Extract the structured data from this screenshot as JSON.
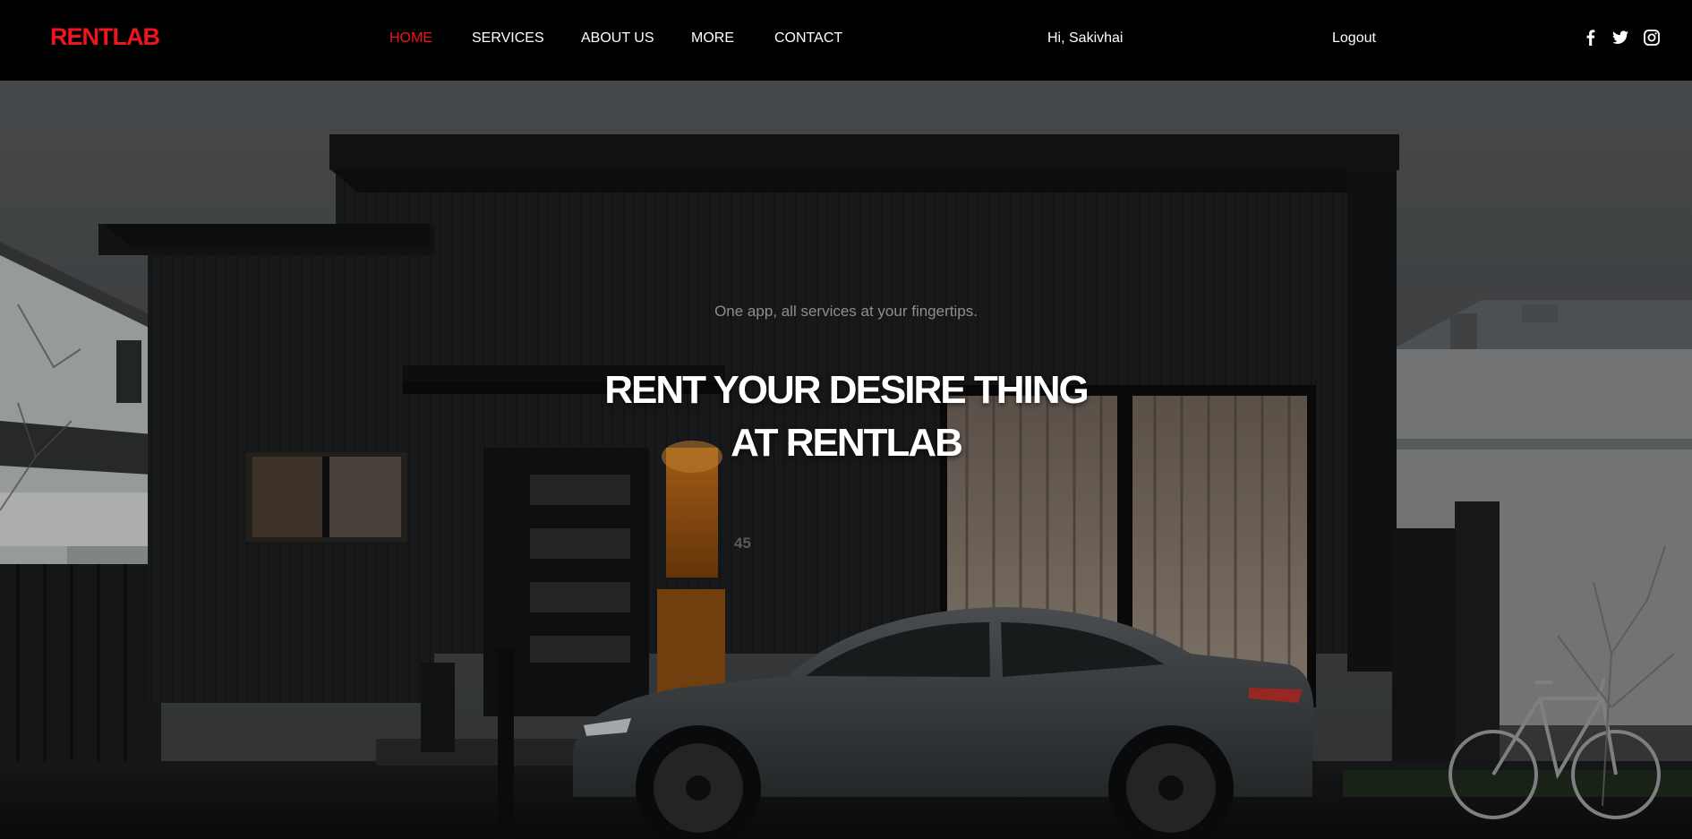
{
  "brand": {
    "name": "RENTLAB",
    "color": "#f0141e"
  },
  "nav": {
    "items": [
      {
        "label": "HOME",
        "active": true
      },
      {
        "label": "SERVICES",
        "active": false
      },
      {
        "label": "ABOUT US",
        "active": false
      },
      {
        "label": "MORE",
        "active": false
      },
      {
        "label": "CONTACT",
        "active": false
      }
    ]
  },
  "user": {
    "greeting": "Hi, Sakivhai",
    "logout_label": "Logout"
  },
  "social": {
    "icons": [
      {
        "name": "facebook-icon"
      },
      {
        "name": "twitter-icon"
      },
      {
        "name": "instagram-icon"
      }
    ]
  },
  "hero": {
    "tagline": "One app, all services at your fingertips.",
    "headline_line1": "RENT YOUR DESIRE THING",
    "headline_line2": "AT RENTLAB",
    "house_number": "45",
    "background_image": "dark modern house with grey sedan and bicycle at dusk"
  },
  "colors": {
    "accent": "#f0141e",
    "navbar_bg": "#000000",
    "text_light": "#ffffff",
    "tagline": "#8e8e8e"
  }
}
